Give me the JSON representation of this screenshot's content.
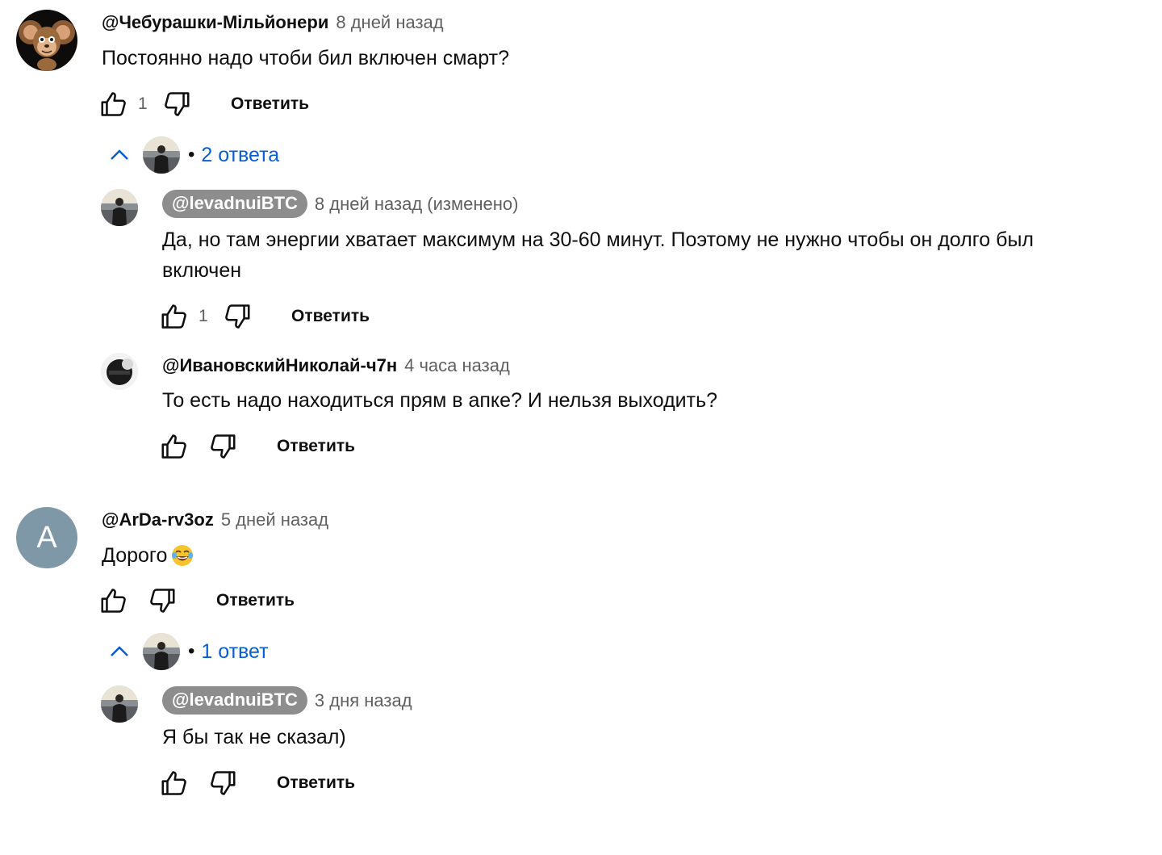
{
  "colors": {
    "link_blue": "#065fd4",
    "secondary_text": "#606060",
    "chip_gray": "#8d8d8d",
    "letter_avatar_bg": "#7f98a8"
  },
  "icons": {
    "like": "thumb-up-icon",
    "dislike": "thumb-down-icon",
    "collapse": "chevron-up-icon",
    "emoji": "face-with-tears-of-joy-icon"
  },
  "threads": [
    {
      "comment": {
        "author": "@Чебурашки-Мільйонери",
        "time": "8 дней назад",
        "text": "Постоянно надо чтоби бил включен смарт?",
        "likes": "1",
        "reply_label": "Ответить"
      },
      "replies_toggle": {
        "label": "2 ответа"
      },
      "replies": [
        {
          "author": "@levadnuiBTC",
          "time": "8 дней назад (изменено)",
          "text": "Да, но там энергии хватает максимум на 30-60 минут. Поэтому не нужно чтобы он долго был включен",
          "likes": "1",
          "reply_label": "Ответить"
        },
        {
          "author": "@ИвановскийНиколай-ч7н",
          "time": "4 часа назад",
          "text": "То есть надо находиться прям в апке? И нельзя выходить?",
          "likes": "",
          "reply_label": "Ответить"
        }
      ]
    },
    {
      "comment": {
        "author": "@ArDa-rv3oz",
        "avatar_letter": "A",
        "time": "5 дней назад",
        "text": "Дорого",
        "likes": "",
        "reply_label": "Ответить"
      },
      "replies_toggle": {
        "label": "1 ответ"
      },
      "replies": [
        {
          "author": "@levadnuiBTC",
          "time": "3 дня назад",
          "text": "Я бы так не сказал)",
          "likes": "",
          "reply_label": "Ответить"
        }
      ]
    }
  ]
}
